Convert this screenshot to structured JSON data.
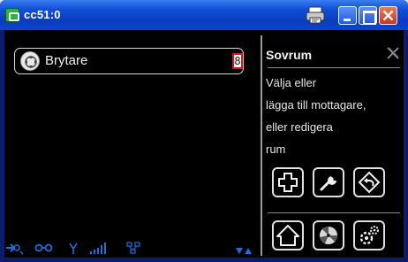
{
  "window": {
    "title": "cc51:0",
    "icons": {
      "app": "app-icon",
      "print": "printer-icon",
      "minimize": "minimize-icon",
      "maximize": "maximize-icon",
      "close": "close-icon"
    }
  },
  "device_list": {
    "items": [
      {
        "label": "Brytare",
        "count": "8",
        "icon": "switch-icon"
      }
    ]
  },
  "side_panel": {
    "title": "Sovrum",
    "close_icon": "close-x-icon",
    "description_lines": [
      "Välja eller",
      "lägga till mottagare,",
      "eller redigera",
      "rum"
    ],
    "actions": [
      {
        "name": "add-receiver-button",
        "icon": "plus-icon"
      },
      {
        "name": "edit-room-button",
        "icon": "wrench-icon"
      },
      {
        "name": "back-button",
        "icon": "back-arrow-icon"
      }
    ],
    "nav": [
      {
        "name": "home-button",
        "icon": "home-icon"
      },
      {
        "name": "scenes-button",
        "icon": "fan-icon"
      },
      {
        "name": "settings-button",
        "icon": "gears-icon"
      }
    ]
  },
  "status_bar": {
    "icons": [
      "connection-icon",
      "link-icon",
      "antenna-icon",
      "signal-strength-icon",
      "network-icon",
      "scroll-arrows-icon"
    ],
    "colors": {
      "icon": "#1f6fd6"
    }
  }
}
